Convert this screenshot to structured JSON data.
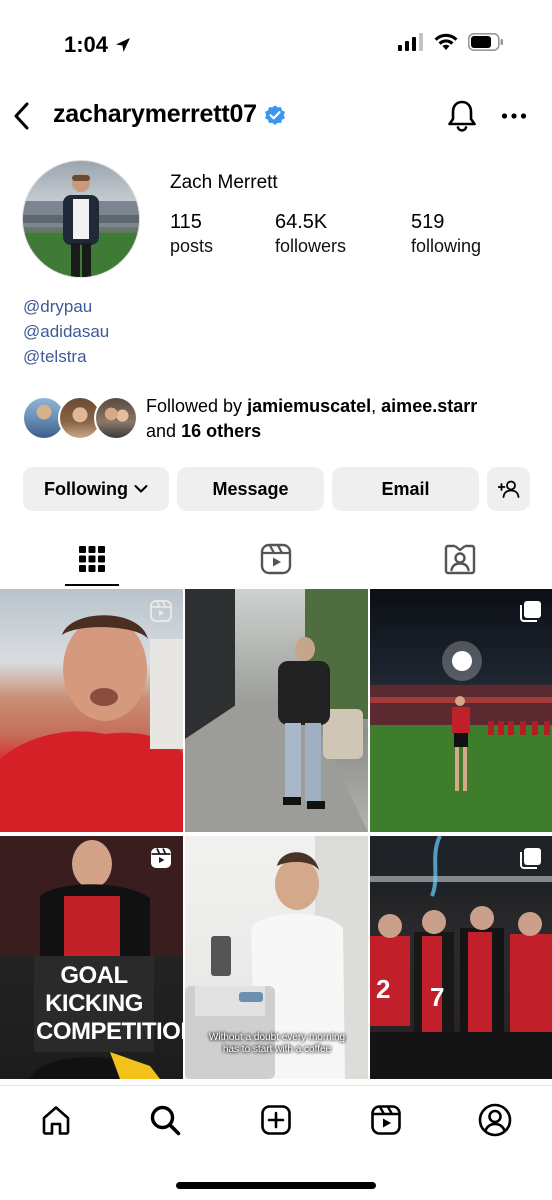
{
  "status_bar": {
    "time": "1:04",
    "icons": [
      "location-arrow-icon",
      "signal-icon",
      "wifi-icon",
      "battery-icon"
    ]
  },
  "header": {
    "username": "zacharymerrett07",
    "verified": true,
    "icons": [
      "back-chevron-icon",
      "verified-badge-icon",
      "bell-icon",
      "more-icon"
    ]
  },
  "profile": {
    "display_name": "Zach Merrett",
    "stats": [
      {
        "value": "115",
        "label": "posts"
      },
      {
        "value": "64.5K",
        "label": "followers"
      },
      {
        "value": "519",
        "label": "following"
      }
    ],
    "links": [
      "@drypau",
      "@adidasau",
      "@telstra"
    ],
    "followed_by": {
      "prefix": "Followed by",
      "user1": "jamiemuscatel",
      "separator": ",",
      "user2": "aimee.starr",
      "and": "and",
      "others": "16 others"
    }
  },
  "actions": {
    "following": "Following",
    "message": "Message",
    "email": "Email",
    "add_user_icon": "add-person-icon"
  },
  "tabs": [
    {
      "name": "grid",
      "icon": "grid-icon",
      "active": true
    },
    {
      "name": "reels",
      "icon": "reels-icon",
      "active": false
    },
    {
      "name": "tagged",
      "icon": "tagged-icon",
      "active": false
    }
  ],
  "posts": {
    "goal_title": "GOAL KICKING COMPETITION",
    "coffee_caption": "Without a doubt every morning has to start with a coffee"
  },
  "bottom_nav": [
    "home-icon",
    "search-icon",
    "create-icon",
    "reels-icon",
    "profile-icon"
  ],
  "colors": {
    "link": "#3c5a98",
    "verified": "#3897f0",
    "button_bg": "#efefef"
  }
}
